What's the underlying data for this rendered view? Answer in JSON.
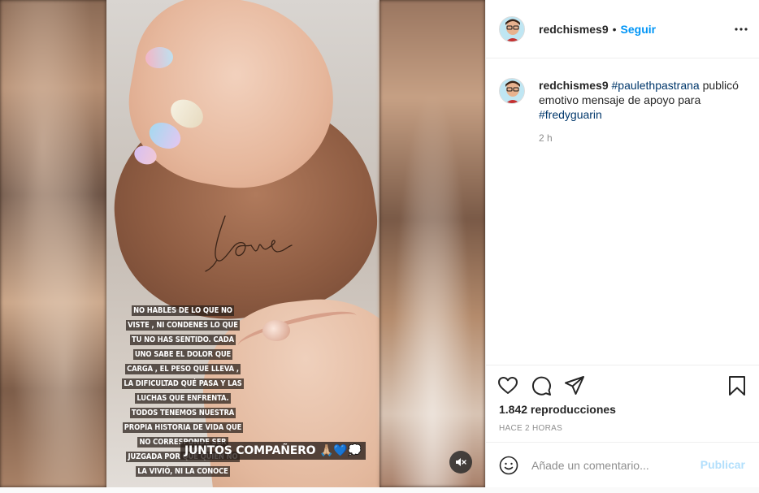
{
  "post": {
    "username": "redchismes9",
    "follow_label": "Seguir",
    "separator": "•",
    "more_icon": "more-horizontal-icon"
  },
  "caption": {
    "username": "redchismes9",
    "hashtag1": "#paulethpastrana",
    "text": " publicó emotivo mensaje de apoyo para ",
    "hashtag2": "#fredyguarin",
    "time": "2 h"
  },
  "story": {
    "text": "NO HABLES DE LO QUE NO VISTE , NI CONDENES LO QUE TU NO HAS SENTIDO. CADA UNO SABE EL DOLOR QUE CARGA , EL PESO QUE LLEVA , LA DIFICULTAD QUÉ PASA Y LAS LUCHAS QUE ENFRENTA. TODOS TENEMOS NUESTRA PROPIA HISTORIA DE VIDA QUE NO CORRESPONDE SER JUZGADA POR QUE QUIEN NO LA VIVIÓ, NI LA CONOCE",
    "caption": "JUNTOS COMPAÑERO 🙏🏼💙💭",
    "handwriting": "love"
  },
  "actions": {
    "views": "1.842 reproducciones",
    "ago": "HACE 2 HORAS",
    "comment_placeholder": "Añade un comentario...",
    "publish_label": "Publicar"
  },
  "colors": {
    "accent": "#0095f6",
    "publish_disabled": "#b2dffc",
    "hashtag": "#00376b",
    "muted": "#8e8e8e"
  }
}
